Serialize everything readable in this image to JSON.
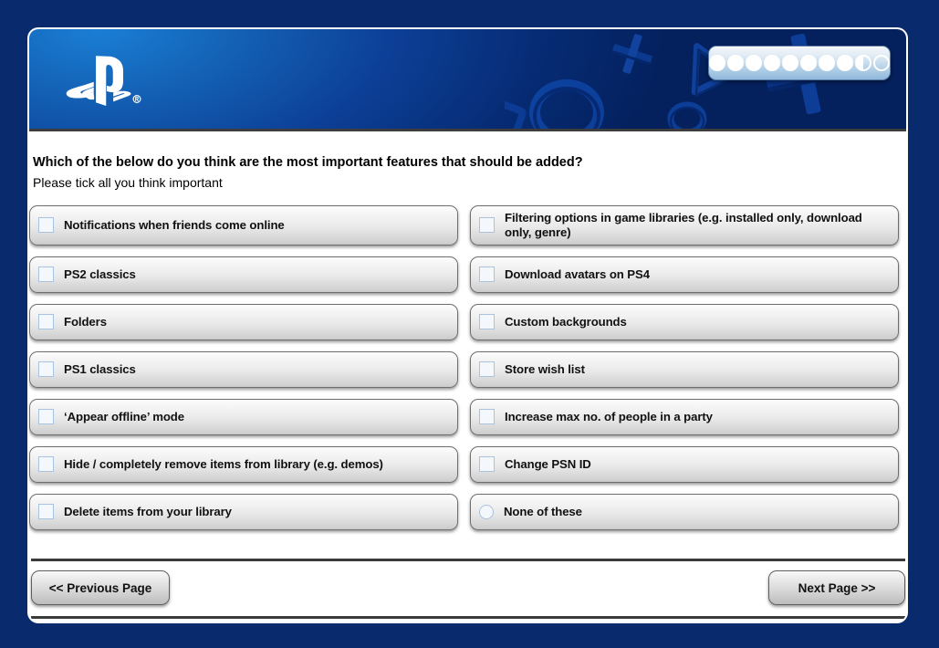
{
  "banner": {
    "logo_icon": "playstation-logo-icon",
    "shapes_icon": "playstation-face-buttons-icon",
    "progress": {
      "total": 10,
      "filled": 8,
      "half": 1,
      "empty": 1,
      "dots": [
        "full",
        "full",
        "full",
        "full",
        "full",
        "full",
        "full",
        "full",
        "half",
        "empty"
      ]
    }
  },
  "question": {
    "title": "Which of the below do you think are the most important features that should be added?",
    "subtitle": "Please tick all you think important"
  },
  "options": {
    "left": [
      {
        "label": "Notifications when friends come online",
        "control": "checkbox",
        "checked": false
      },
      {
        "label": "PS2 classics",
        "control": "checkbox",
        "checked": false
      },
      {
        "label": "Folders",
        "control": "checkbox",
        "checked": false
      },
      {
        "label": "PS1 classics",
        "control": "checkbox",
        "checked": false
      },
      {
        "label": "‘Appear offline’ mode",
        "control": "checkbox",
        "checked": false
      },
      {
        "label": "Hide / completely remove items from library (e.g. demos)",
        "control": "checkbox",
        "checked": false
      },
      {
        "label": "Delete items from your library",
        "control": "checkbox",
        "checked": false
      }
    ],
    "right": [
      {
        "label": "Filtering options in game libraries (e.g. installed only, download only, genre)",
        "control": "checkbox",
        "checked": false
      },
      {
        "label": "Download avatars on PS4",
        "control": "checkbox",
        "checked": false
      },
      {
        "label": "Custom backgrounds",
        "control": "checkbox",
        "checked": false
      },
      {
        "label": "Store wish list",
        "control": "checkbox",
        "checked": false
      },
      {
        "label": "Increase max no. of people in a party",
        "control": "checkbox",
        "checked": false
      },
      {
        "label": "Change PSN ID",
        "control": "checkbox",
        "checked": false
      },
      {
        "label": "None of these",
        "control": "radio",
        "checked": false
      }
    ]
  },
  "navigation": {
    "previous_label": "<< Previous Page",
    "next_label": "Next Page >>"
  },
  "colors": {
    "page_background": "#0a2a6e",
    "banner_blue_light": "#1a7fd4",
    "banner_blue_dark": "#04215e",
    "card_background": "#ffffff",
    "option_border": "#6e6e6e",
    "checkbox_border": "#a9c3de",
    "rule": "#3b3b3b"
  }
}
